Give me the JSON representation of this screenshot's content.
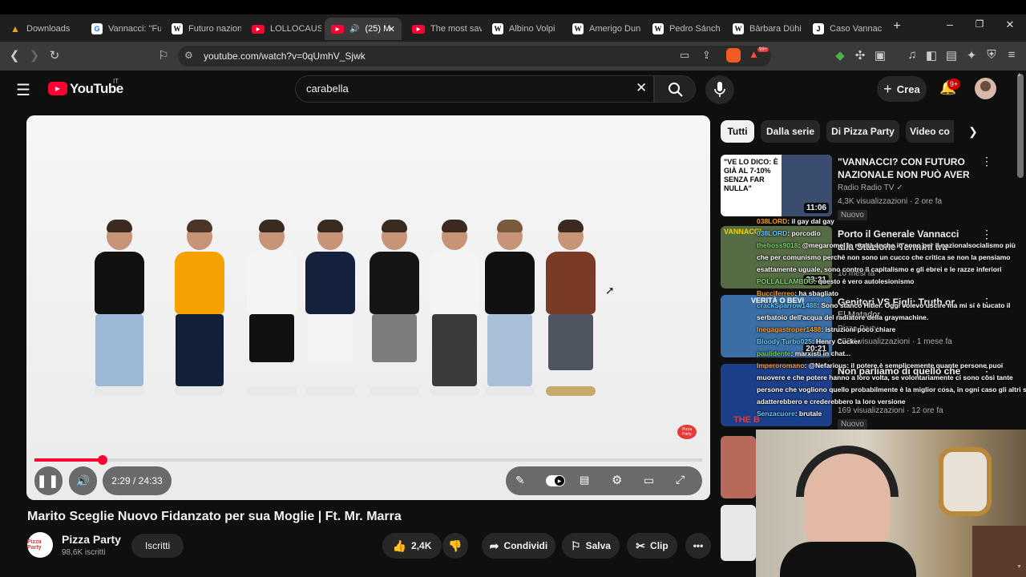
{
  "browser": {
    "tabs": [
      {
        "label": "Downloads",
        "icon": "download-icon"
      },
      {
        "label": "Vannacci: \"Fu",
        "icon": "google-icon"
      },
      {
        "label": "Futuro nazion",
        "icon": "wikipedia-icon"
      },
      {
        "label": "LOLLOCAUST",
        "icon": "youtube-icon"
      },
      {
        "label": "(25) M",
        "icon": "youtube-icon",
        "active": true
      },
      {
        "label": "The most sav",
        "icon": "youtube-icon"
      },
      {
        "label": "Albino Volpi",
        "icon": "wikipedia-icon"
      },
      {
        "label": "Amerigo Dun",
        "icon": "wikipedia-icon"
      },
      {
        "label": "Pedro Sánch",
        "icon": "wikipedia-icon"
      },
      {
        "label": "Bàrbara Dühi",
        "icon": "wikipedia-icon"
      },
      {
        "label": "Caso Vannac",
        "icon": "justice-icon"
      }
    ],
    "url": "youtube.com/watch?v=0qUmhV_Sjwk",
    "extension_badge": "99+"
  },
  "youtube": {
    "logo_text": "YouTube",
    "region": "IT",
    "search_value": "carabella",
    "create_label": "Crea",
    "notifications": "9+"
  },
  "player": {
    "time": "2:29 / 24:33",
    "progress_fraction": 0.102,
    "watermark": "Pizza Party"
  },
  "video": {
    "title": "Marito Sceglie Nuovo Fidanzato per sua Moglie | Ft. Mr. Marra",
    "channel": "Pizza Party",
    "subscribers": "98,6K iscritti",
    "subscribe_label": "Iscritti",
    "likes": "2,4K",
    "share_label": "Condividi",
    "save_label": "Salva",
    "clip_label": "Clip",
    "avatar_text": "Pizza Party"
  },
  "chips": [
    "Tutti",
    "Dalla serie",
    "Di Pizza Party",
    "Video co"
  ],
  "recommended": [
    {
      "title": "\"VANNACCI? CON FUTURO NAZIONALE NON PUÒ AVER ...",
      "channel": "Radio Radio TV ✓",
      "meta": "4,3K visualizzazioni · 2 ore fa",
      "badge": "Nuovo",
      "duration": "11:06",
      "thumb_text": "\"VE LO DICO: È GIÀ AL 7-10% SENZA FAR NULLA\""
    },
    {
      "title": "Porto il Generale Vannacci alla Stazione Termini tra degrado",
      "channel": "",
      "meta": "10 mesi fa",
      "badge": "",
      "duration": "23:31",
      "thumb_text": "VANNACCI"
    },
    {
      "title": "Genitori VS Figli: Truth or Drink |",
      "channel": "Pizza Party",
      "meta": "222K visualizzazioni · 1 mese fa",
      "badge": "",
      "duration": "20:21",
      "thumb_text": "VERITÀ O BEVI",
      "subtitle": "El Matador"
    },
    {
      "title": "Non parliamo di quello che ha",
      "channel": "",
      "meta": "169 visualizzazioni · 12 ore fa",
      "badge": "Nuovo",
      "duration": "",
      "thumb_text": "THE B"
    }
  ],
  "chat_overlay": [
    {
      "user": "038LORD",
      "text": ": il gay dal gay"
    },
    {
      "user": "038LORD",
      "text": ": porcodio"
    },
    {
      "user": "theboss9018",
      "text": ": @megaromel in realtà anche io sono per il nazionalsocialismo più"
    },
    {
      "user": "",
      "text": "che per comunismo perchè non sono un cucco che critica se non la pensiamo"
    },
    {
      "user": "",
      "text": "esattamente uguale, sono contro il capitalismo e gli ebrei e le razze inferiori"
    },
    {
      "user": "POLLALLAMBDG",
      "text": ": questo è vero autolesionismo"
    },
    {
      "user": "Bucciferreo",
      "text": ": ha sbagliato"
    },
    {
      "user": "crackSparrow1488",
      "text": ": Sono stanco Hitler. Oggi volevo uscire ma mi si è bucato il"
    },
    {
      "user": "",
      "text": "serbatoio dell'acqua del radiatore della graymachine."
    },
    {
      "user": "lnegagastroper1488",
      "text": ": istruzioni poco chiare"
    },
    {
      "user": "Bloody Turbo025",
      "text": ": Henry Cucker"
    },
    {
      "user": "paulidente",
      "text": ": marxisti in chat..."
    },
    {
      "user": "Imperoromano",
      "text": ": @Nefarious: il potere è semplicemente quante persone puoi"
    },
    {
      "user": "",
      "text": "muovere e che potere hanno a loro volta, se volontariamente ci sono così tante"
    },
    {
      "user": "",
      "text": "persone che vogliono quello probabilmente è la miglior cosa, in ogni caso gli altri si"
    },
    {
      "user": "",
      "text": "adatterebbero e crederebbero la loro versione"
    },
    {
      "user": "Senzacuore",
      "text": ": brutale"
    }
  ],
  "colors": {
    "accent": "#ff0033",
    "bg": "#0f0f0f",
    "chip_selected": "#f1f1f1"
  }
}
